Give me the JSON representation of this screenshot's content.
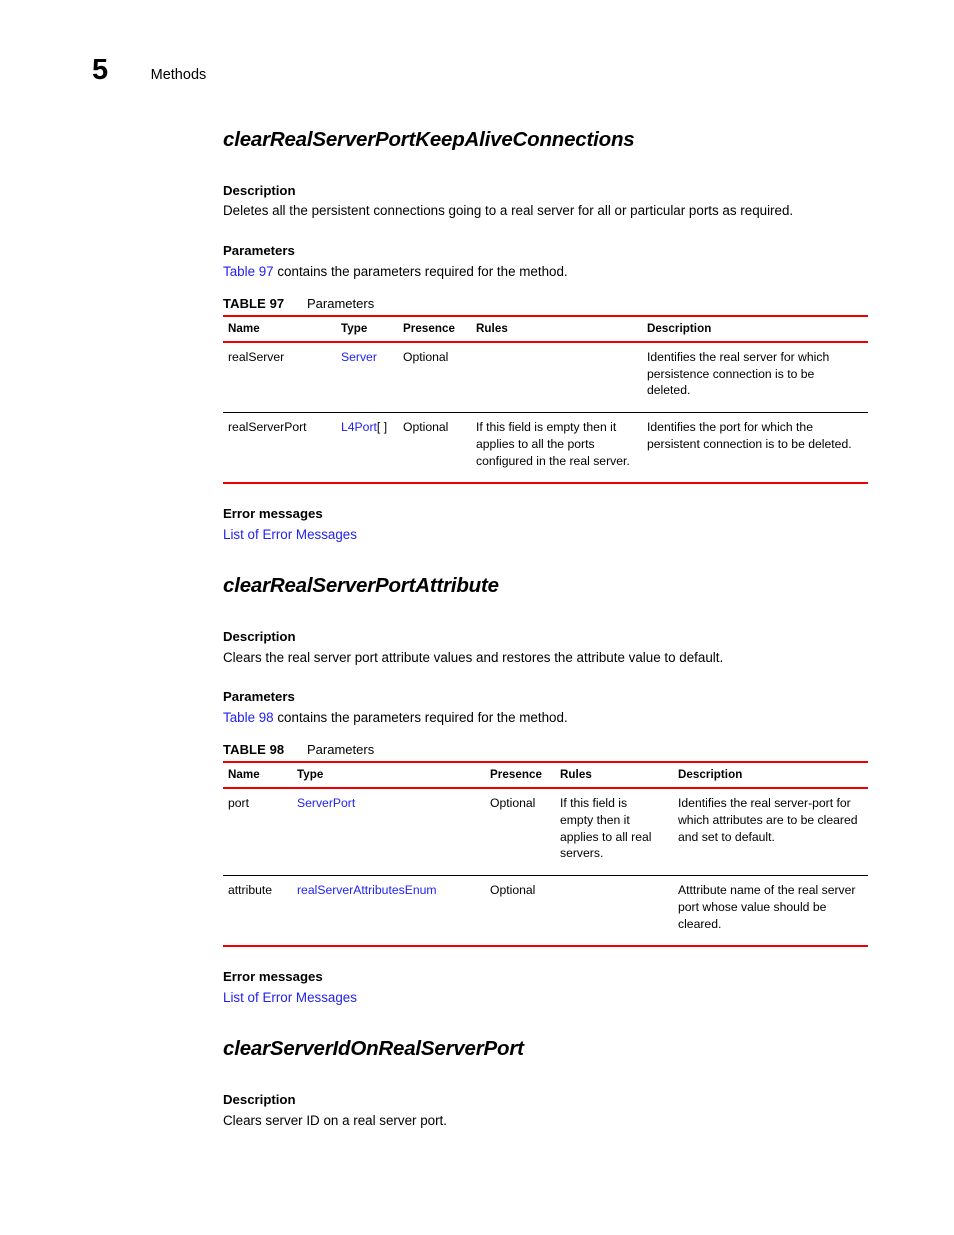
{
  "running_header": {
    "chapter_number": "5",
    "chapter_title": "Methods"
  },
  "sections": [
    {
      "title": "clearRealServerPortKeepAliveConnections",
      "description_heading": "Description",
      "description_text": "Deletes all the persistent connections going to a real server for all or particular ports as required.",
      "parameters_heading": "Parameters",
      "parameters_link": "Table 97",
      "parameters_sentence": " contains the parameters required for the method.",
      "table": {
        "caption_number": "TABLE 97",
        "caption_title": "Parameters",
        "columns": [
          "Name",
          "Type",
          "Presence",
          "Rules",
          "Description"
        ],
        "rows": [
          {
            "name": "realServer",
            "type": "Server",
            "type_suffix": "",
            "presence": "Optional",
            "rules": "",
            "description": "Identifies the real server for which persistence connection is to be deleted."
          },
          {
            "name": "realServerPort",
            "type": "L4Port",
            "type_suffix": "[ ]",
            "presence": "Optional",
            "rules": "If this field is empty then it applies to all the ports configured in the real server.",
            "description": "Identifies the port for which the persistent connection is to be deleted."
          }
        ]
      },
      "error_heading": "Error messages",
      "error_link": "List of Error Messages"
    },
    {
      "title": "clearRealServerPortAttribute",
      "description_heading": "Description",
      "description_text": "Clears the real server port attribute values and restores the attribute value to default.",
      "parameters_heading": "Parameters",
      "parameters_link": "Table 98",
      "parameters_sentence": " contains the parameters required for the method.",
      "table": {
        "caption_number": "TABLE 98",
        "caption_title": "Parameters",
        "columns": [
          "Name",
          "Type",
          "Presence",
          "Rules",
          "Description"
        ],
        "rows": [
          {
            "name": "port",
            "type": "ServerPort",
            "type_suffix": "",
            "presence": "Optional",
            "rules": "If this field is empty then it applies to all real servers.",
            "description": "Identifies the real server-port for which attributes are to be cleared and set to default."
          },
          {
            "name": "attribute",
            "type": "realServerAttributesEnum",
            "type_suffix": "",
            "presence": "Optional",
            "rules": "",
            "description": "Atttribute name of the real server port whose value should be cleared."
          }
        ]
      },
      "error_heading": "Error messages",
      "error_link": "List of Error Messages"
    },
    {
      "title": "clearServerIdOnRealServerPort",
      "description_heading": "Description",
      "description_text": "Clears server ID on a real server port.",
      "parameters_heading": null,
      "parameters_link": null,
      "parameters_sentence": null,
      "table": null,
      "error_heading": null,
      "error_link": null
    }
  ],
  "colors": {
    "rule_red": "#ee0000",
    "link_blue": "#2222ee",
    "text_black": "#000000"
  }
}
